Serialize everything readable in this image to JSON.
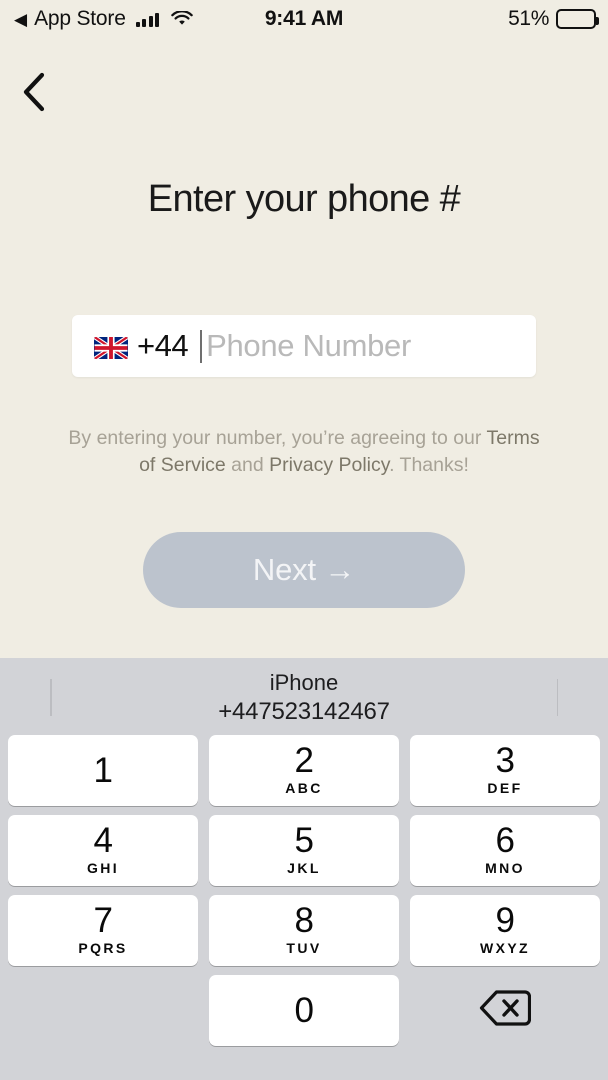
{
  "status_bar": {
    "back_arrow": "◀",
    "app_name": "App Store",
    "signal_icon": "cellular-signal-icon",
    "wifi_icon": "wifi-icon",
    "time": "9:41 AM",
    "battery_percent": "51%",
    "battery_icon": "battery-icon"
  },
  "nav": {
    "back_icon": "chevron-left-icon"
  },
  "page": {
    "title": "Enter your phone #"
  },
  "phone_field": {
    "flag": "🇬🇧",
    "flag_icon": "uk-flag-icon",
    "dial_code": "+44",
    "value": "",
    "placeholder": "Phone Number"
  },
  "legal": {
    "line1_before": "By entering your number, you’re agreeing to our",
    "terms_link": "Terms of Service",
    "between": " and ",
    "privacy_link": "Privacy Policy",
    "line2_after": ". Thanks!"
  },
  "next_button": {
    "label": "Next →",
    "color": "#bcc3cd",
    "text_color": "#f3f4f6",
    "enabled": false
  },
  "keyboard": {
    "suggestion": {
      "label": "iPhone",
      "value": "+447523142467"
    },
    "rows": [
      [
        {
          "num": "1",
          "letters": ""
        },
        {
          "num": "2",
          "letters": "ABC"
        },
        {
          "num": "3",
          "letters": "DEF"
        }
      ],
      [
        {
          "num": "4",
          "letters": "GHI"
        },
        {
          "num": "5",
          "letters": "JKL"
        },
        {
          "num": "6",
          "letters": "MNO"
        }
      ],
      [
        {
          "num": "7",
          "letters": "PQRS"
        },
        {
          "num": "8",
          "letters": "TUV"
        },
        {
          "num": "9",
          "letters": "WXYZ"
        }
      ],
      [
        {
          "num": "",
          "letters": "",
          "type": "spacer"
        },
        {
          "num": "0",
          "letters": ""
        },
        {
          "num": "",
          "letters": "",
          "type": "delete",
          "icon": "backspace-icon"
        }
      ]
    ]
  },
  "colors": {
    "background": "#f0ede3",
    "keyboard_background": "#d2d3d7",
    "key_background": "#ffffff",
    "placeholder": "#b9b9b9",
    "legal_text": "#a7a296",
    "legal_link": "#7d7869"
  }
}
